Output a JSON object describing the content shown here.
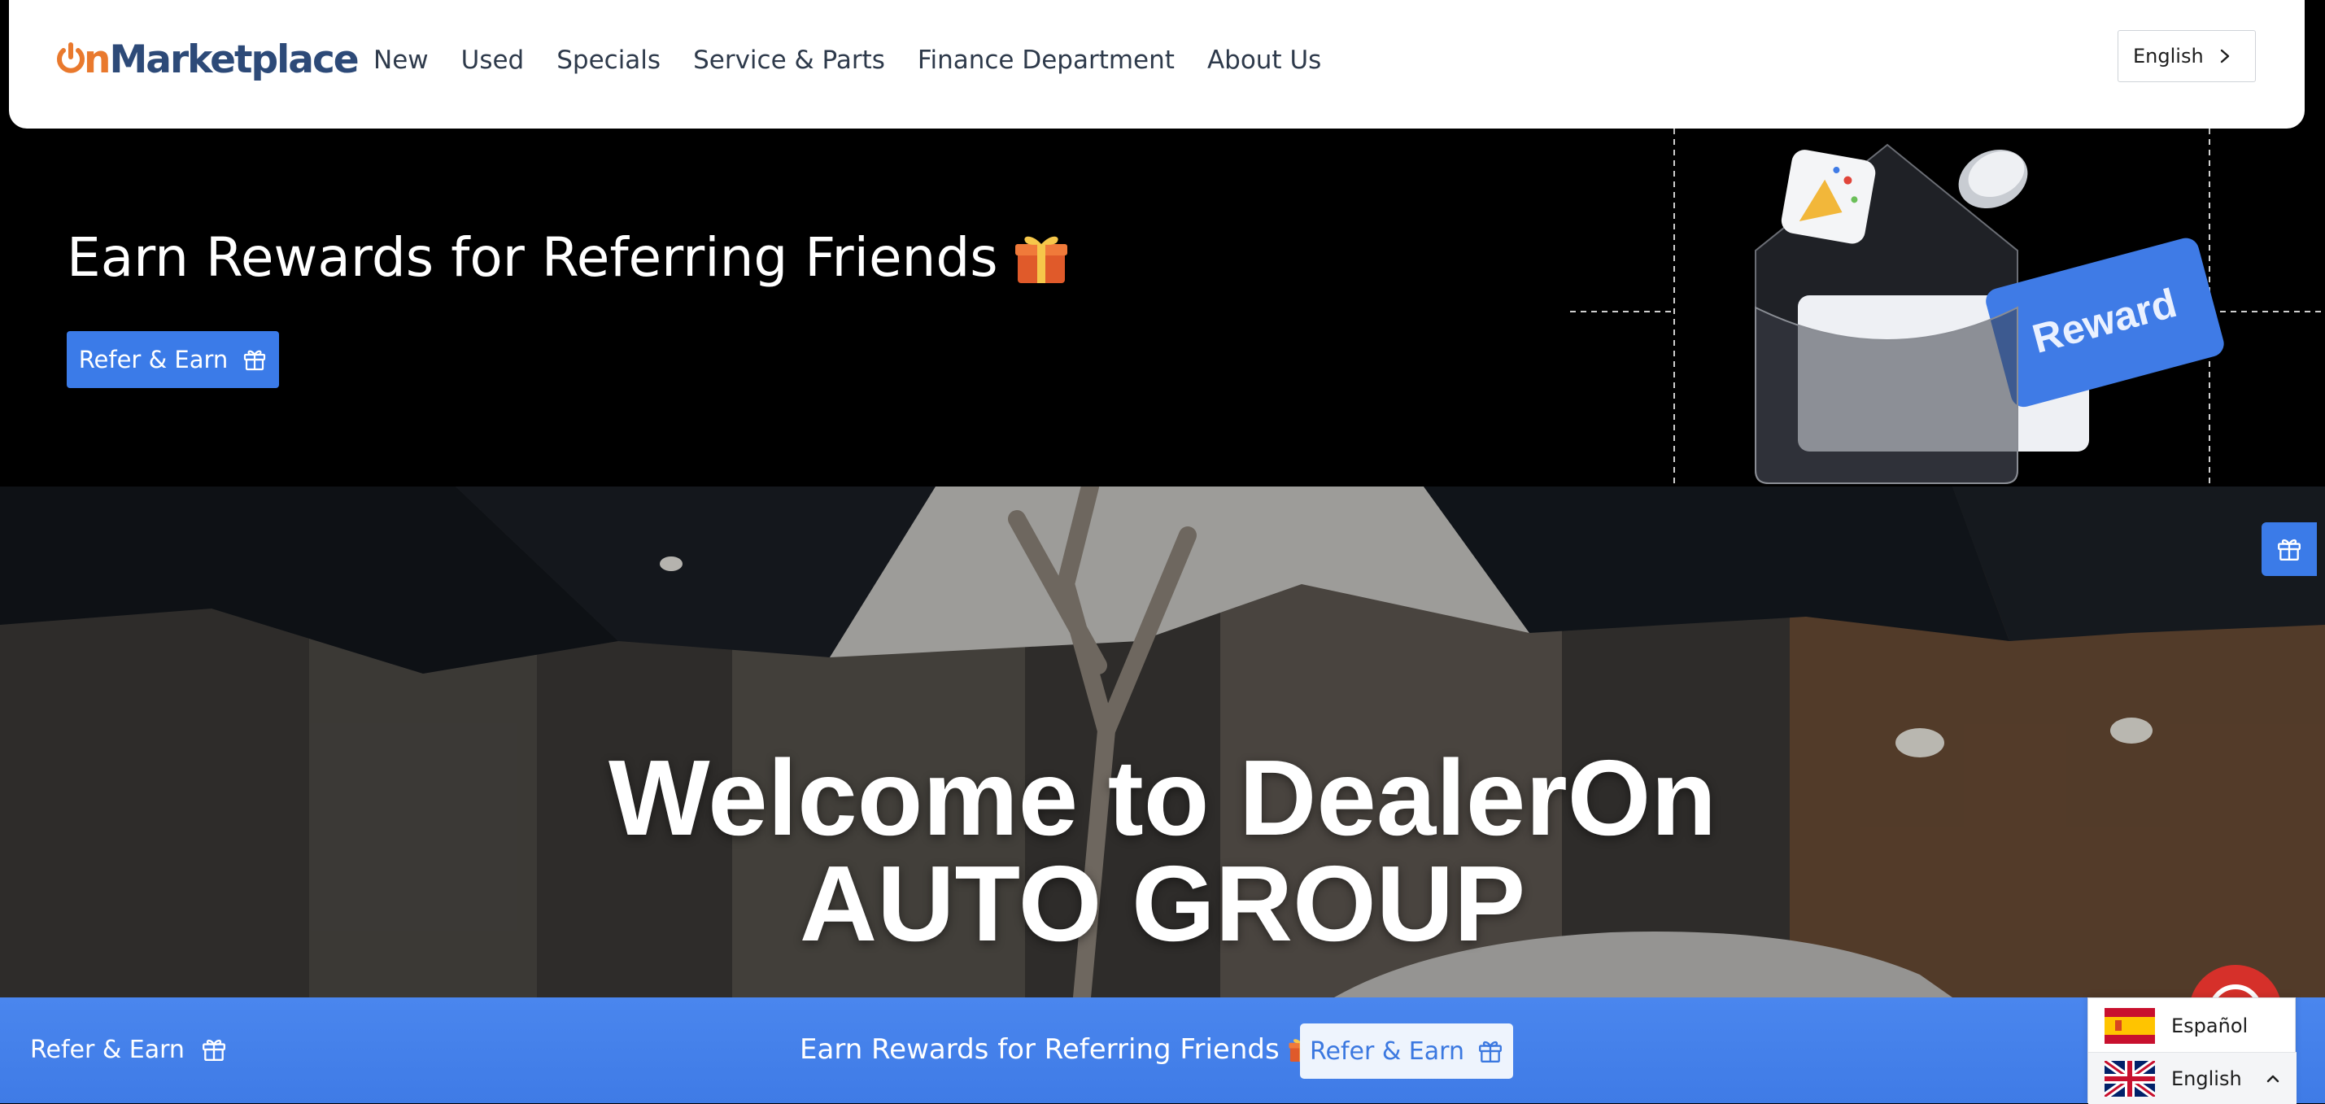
{
  "header": {
    "logo": {
      "on": "On",
      "rest": "Marketplace"
    },
    "nav": [
      {
        "label": "New"
      },
      {
        "label": "Used"
      },
      {
        "label": "Specials"
      },
      {
        "label": "Service & Parts"
      },
      {
        "label": "Finance Department"
      },
      {
        "label": "About Us"
      }
    ],
    "language_button": {
      "label": "English",
      "icon": "chevron-right-icon"
    }
  },
  "promo": {
    "title": "Earn Rewards for Referring Friends",
    "title_icon": "gift-icon",
    "button_label": "Refer & Earn",
    "button_icon": "gift-outline-icon",
    "illustration": {
      "card_label": "Reward",
      "icons": [
        "party-popper-icon",
        "coin-icon",
        "envelope-icon"
      ]
    }
  },
  "hero": {
    "title_line1": "Welcome to DealerOn",
    "title_line2": "AUTO GROUP"
  },
  "side_widget": {
    "icon": "gift-outline-icon"
  },
  "bottom_bar": {
    "left_label": "Refer & Earn",
    "center_text": "Earn Rewards for Referring Friends",
    "button_label": "Refer & Earn"
  },
  "chat": {
    "icon": "chat-icon"
  },
  "language_menu": {
    "options": [
      {
        "label": "Español",
        "flag": "spain-flag-icon"
      },
      {
        "label": "English",
        "flag": "uk-flag-icon",
        "selected": true
      }
    ],
    "toggle_icon": "chevron-up-icon"
  },
  "colors": {
    "brand_orange": "#e9792d",
    "brand_navy": "#2d4a78",
    "accent_blue": "#3b7be8",
    "promo_bg": "#000000",
    "chat_red": "#d6302a"
  }
}
